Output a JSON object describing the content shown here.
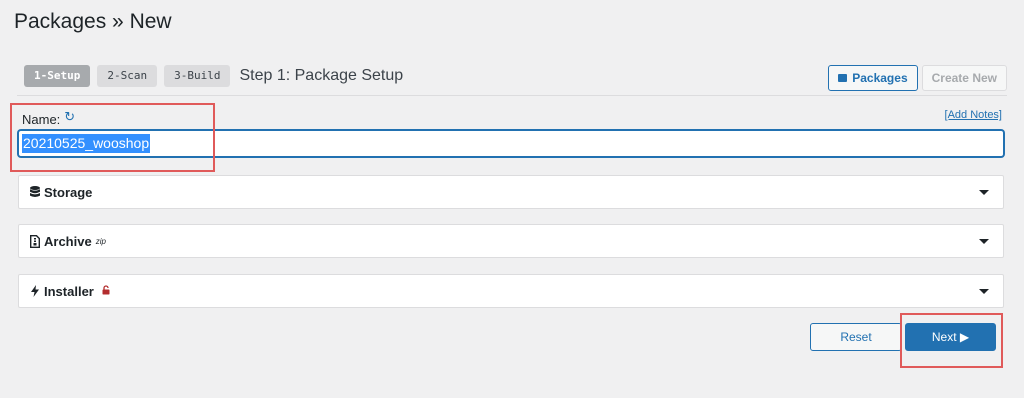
{
  "page": {
    "title": "Packages » New"
  },
  "steps": [
    {
      "label": "1-Setup",
      "active": true
    },
    {
      "label": "2-Scan",
      "active": false
    },
    {
      "label": "3-Build",
      "active": false
    }
  ],
  "step_title": "Step 1: Package Setup",
  "toolbar": {
    "packages_label": "Packages",
    "create_new_label": "Create New"
  },
  "name_field": {
    "label": "Name:",
    "value": "20210525_wooshop",
    "add_notes": "[Add Notes]"
  },
  "panels": [
    {
      "label": "Storage",
      "icon": "database-icon"
    },
    {
      "label": "Archive",
      "sup": "zip",
      "icon": "file-zip-icon"
    },
    {
      "label": "Installer",
      "icon": "bolt-icon",
      "badge_icon": "lock-icon"
    }
  ],
  "actions": {
    "reset_label": "Reset",
    "next_label": "Next ▶"
  },
  "colors": {
    "accent": "#2271b1",
    "highlight": "#e05a5a",
    "selection": "#3390ff"
  }
}
